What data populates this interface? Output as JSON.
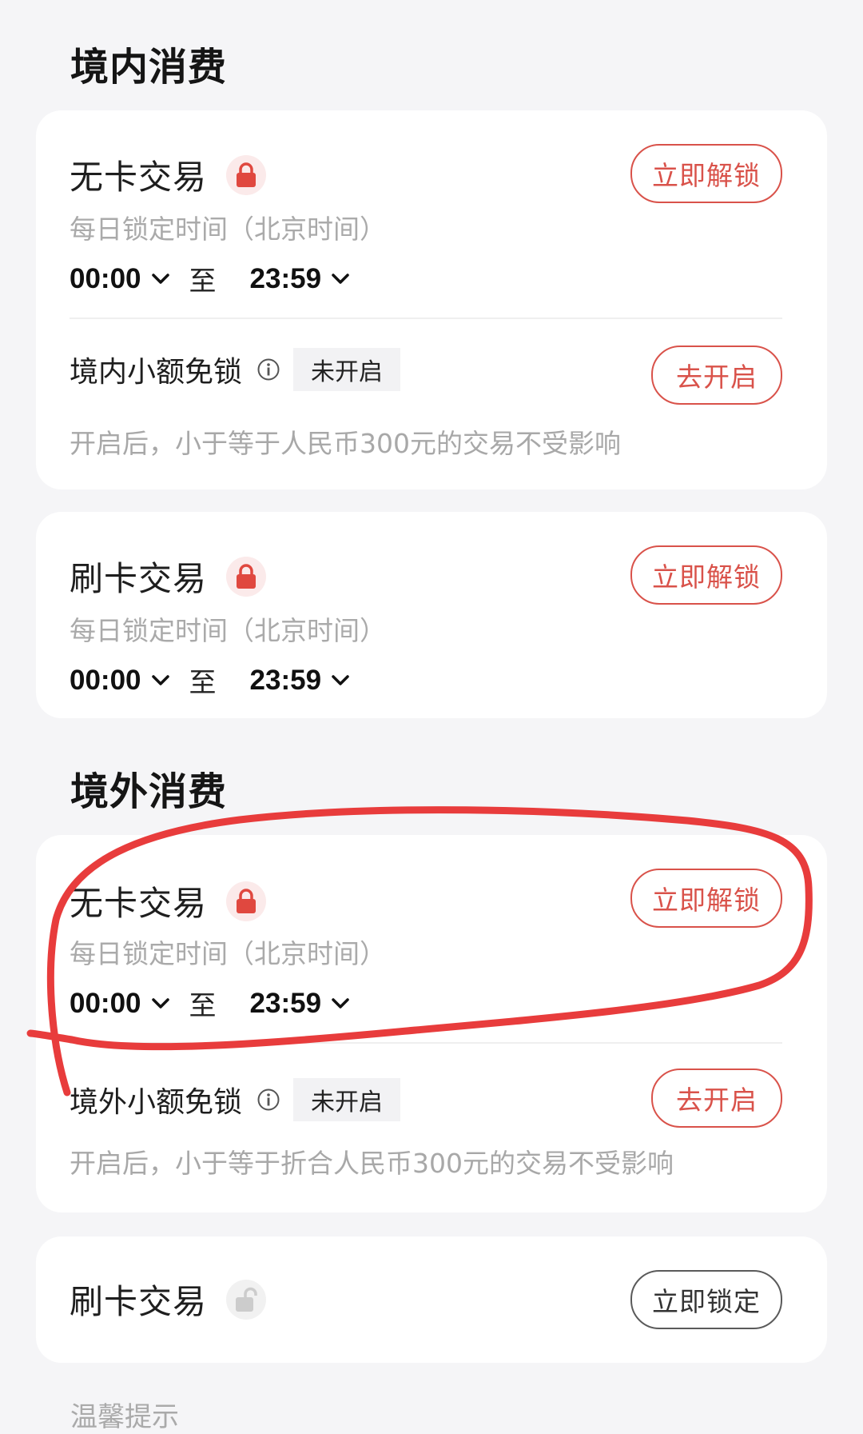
{
  "domestic": {
    "title": "境内消费",
    "cardless": {
      "title": "无卡交易",
      "lock_icon": "lock-icon",
      "sub_label": "每日锁定时间（北京时间）",
      "start": "00:00",
      "to": "至",
      "end": "23:59",
      "action": "立即解锁"
    },
    "small_exempt": {
      "title": "境内小额免锁",
      "info_icon": "info-icon",
      "status": "未开启",
      "action": "去开启",
      "hint": "开启后，小于等于人民币300元的交易不受影响"
    },
    "card_swipe": {
      "title": "刷卡交易",
      "lock_icon": "lock-icon",
      "sub_label": "每日锁定时间（北京时间）",
      "start": "00:00",
      "to": "至",
      "end": "23:59",
      "action": "立即解锁"
    }
  },
  "overseas": {
    "title": "境外消费",
    "cardless": {
      "title": "无卡交易",
      "lock_icon": "lock-icon",
      "sub_label": "每日锁定时间（北京时间）",
      "start": "00:00",
      "to": "至",
      "end": "23:59",
      "action": "立即解锁"
    },
    "small_exempt": {
      "title": "境外小额免锁",
      "info_icon": "info-icon",
      "status": "未开启",
      "action": "去开启",
      "hint": "开启后，小于等于折合人民币300元的交易不受影响"
    },
    "card_swipe": {
      "title": "刷卡交易",
      "lock_icon": "unlock-icon",
      "action": "立即锁定"
    }
  },
  "bottom_cut_text": "温馨提示",
  "colors": {
    "accent_red": "#d9524a",
    "annotation_red": "#e83c3c",
    "page_bg": "#f5f5f7"
  }
}
